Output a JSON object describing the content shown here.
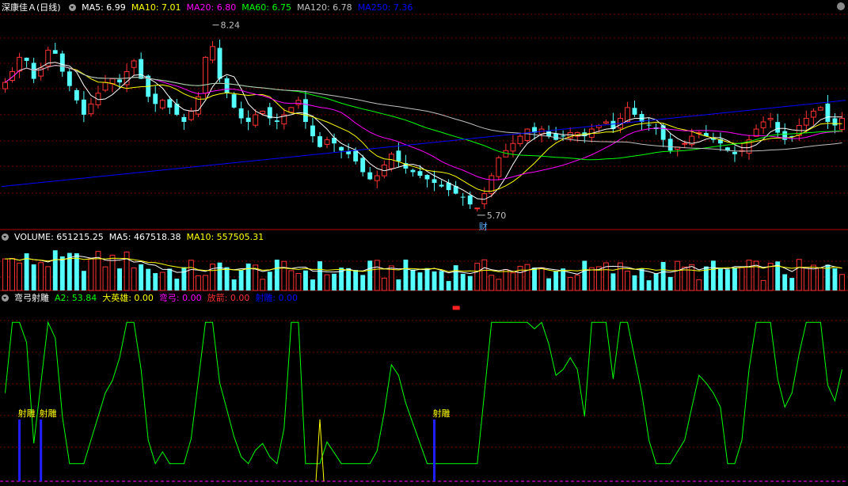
{
  "header_main": {
    "stock_name": "深康佳Ａ",
    "period": "(日线)",
    "ma_items": [
      {
        "label": "MA5: 6.99",
        "color": "#ffffff"
      },
      {
        "label": "MA10: 7.01",
        "color": "#ffff00"
      },
      {
        "label": "MA20: 6.80",
        "color": "#ff00ff"
      },
      {
        "label": "MA60: 6.75",
        "color": "#00ff00"
      },
      {
        "label": "MA120: 6.78",
        "color": "#c0c0c0"
      },
      {
        "label": "MA250: 7.36",
        "color": "#0000ff"
      }
    ]
  },
  "header_volume": {
    "label": "VOLUME: 651215.25",
    "ma5": "MA5: 467518.38",
    "ma10": "MA10: 557505.31"
  },
  "header_indicator": {
    "name": "弯弓射雕",
    "items": [
      {
        "label": "A2: 53.84",
        "color": "#00ff00"
      },
      {
        "label": "大英雄: 0.00",
        "color": "#ffff00"
      },
      {
        "label": "弯弓: 0.00",
        "color": "#ff00ff"
      },
      {
        "label": "放箭: 0.00",
        "color": "#ff3030"
      },
      {
        "label": "射雕: 0.00",
        "color": "#0000ff"
      }
    ]
  },
  "colors": {
    "up": "#ff3232",
    "down": "#54ffff",
    "ma5": "#ffffff",
    "ma10": "#ffff00",
    "ma20": "#ff00ff",
    "ma60": "#00ff00",
    "ma120": "#c0c0c0",
    "ma250": "#0000ff",
    "grid": "#7a0000",
    "divider": "#b00000"
  },
  "chart_data": {
    "type": "candlestick",
    "price_range": [
      5.5,
      8.5
    ],
    "high_label": "8.24",
    "low_label": "5.70",
    "finance_marker": "财",
    "candles_close": [
      7.55,
      7.7,
      7.9,
      7.85,
      7.6,
      7.75,
      8.0,
      7.95,
      7.7,
      7.5,
      7.3,
      7.1,
      7.25,
      7.4,
      7.55,
      7.6,
      7.55,
      7.7,
      7.85,
      7.6,
      7.35,
      7.25,
      7.3,
      7.2,
      7.1,
      7.0,
      7.15,
      7.35,
      7.9,
      8.05,
      7.6,
      7.4,
      7.2,
      7.05,
      7.0,
      7.1,
      7.15,
      7.05,
      7.0,
      7.1,
      7.2,
      7.3,
      7.0,
      6.8,
      6.65,
      6.75,
      6.7,
      6.6,
      6.55,
      6.45,
      6.3,
      6.2,
      6.25,
      6.4,
      6.55,
      6.45,
      6.35,
      6.3,
      6.25,
      6.2,
      6.15,
      6.1,
      6.05,
      6.0,
      5.95,
      5.85,
      5.8,
      6.0,
      6.25,
      6.5,
      6.6,
      6.7,
      6.8,
      6.9,
      6.85,
      6.9,
      6.8,
      6.75,
      6.8,
      6.85,
      6.85,
      6.8,
      6.9,
      6.95,
      7.0,
      6.9,
      7.05,
      7.2,
      7.1,
      7.0,
      6.95,
      6.9,
      6.75,
      6.6,
      6.65,
      6.7,
      6.8,
      6.85,
      6.8,
      6.75,
      6.7,
      6.6,
      6.55,
      6.6,
      6.75,
      6.9,
      7.0,
      7.05,
      6.85,
      6.75,
      6.8,
      6.95,
      7.05,
      7.15,
      7.2,
      7.0,
      6.95,
      7.05
    ],
    "volume_range": [
      0,
      1500000
    ],
    "indicator_range": [
      0,
      100
    ],
    "signal_label": "射雕"
  }
}
